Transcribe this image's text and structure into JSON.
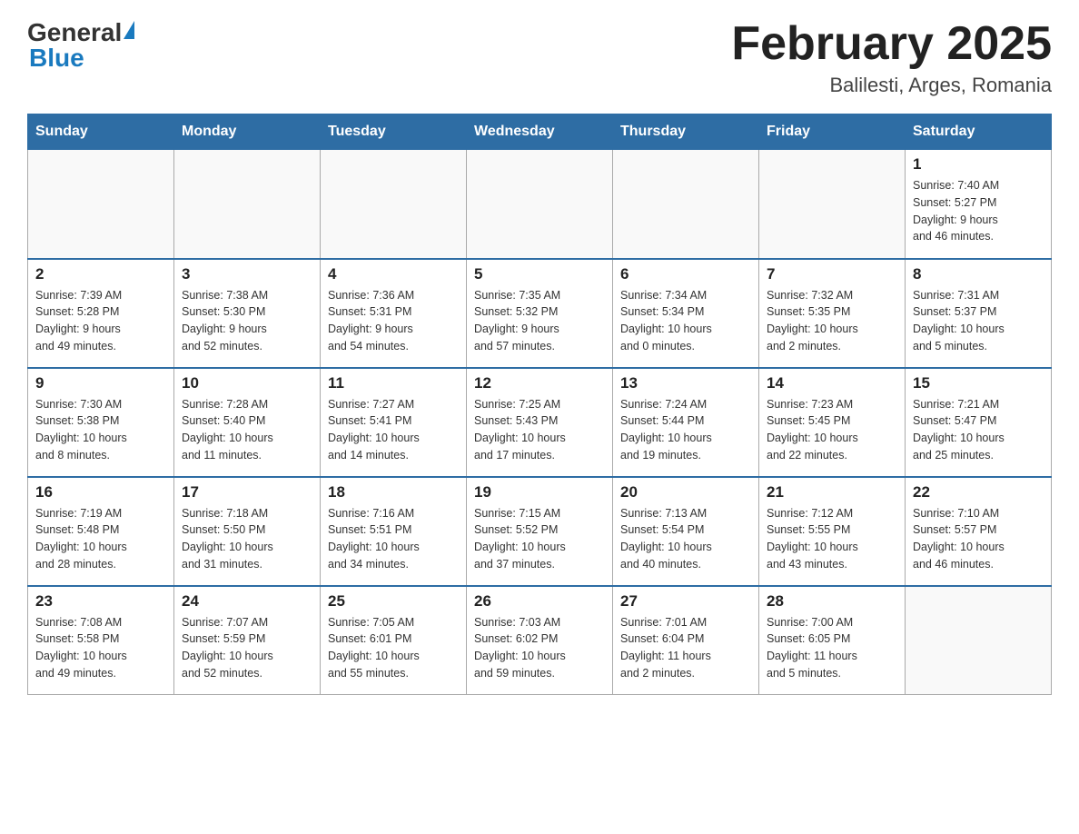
{
  "header": {
    "logo_general": "General",
    "logo_blue": "Blue",
    "title": "February 2025",
    "subtitle": "Balilesti, Arges, Romania"
  },
  "days_of_week": [
    "Sunday",
    "Monday",
    "Tuesday",
    "Wednesday",
    "Thursday",
    "Friday",
    "Saturday"
  ],
  "weeks": [
    {
      "days": [
        {
          "num": "",
          "info": ""
        },
        {
          "num": "",
          "info": ""
        },
        {
          "num": "",
          "info": ""
        },
        {
          "num": "",
          "info": ""
        },
        {
          "num": "",
          "info": ""
        },
        {
          "num": "",
          "info": ""
        },
        {
          "num": "1",
          "info": "Sunrise: 7:40 AM\nSunset: 5:27 PM\nDaylight: 9 hours\nand 46 minutes."
        }
      ]
    },
    {
      "days": [
        {
          "num": "2",
          "info": "Sunrise: 7:39 AM\nSunset: 5:28 PM\nDaylight: 9 hours\nand 49 minutes."
        },
        {
          "num": "3",
          "info": "Sunrise: 7:38 AM\nSunset: 5:30 PM\nDaylight: 9 hours\nand 52 minutes."
        },
        {
          "num": "4",
          "info": "Sunrise: 7:36 AM\nSunset: 5:31 PM\nDaylight: 9 hours\nand 54 minutes."
        },
        {
          "num": "5",
          "info": "Sunrise: 7:35 AM\nSunset: 5:32 PM\nDaylight: 9 hours\nand 57 minutes."
        },
        {
          "num": "6",
          "info": "Sunrise: 7:34 AM\nSunset: 5:34 PM\nDaylight: 10 hours\nand 0 minutes."
        },
        {
          "num": "7",
          "info": "Sunrise: 7:32 AM\nSunset: 5:35 PM\nDaylight: 10 hours\nand 2 minutes."
        },
        {
          "num": "8",
          "info": "Sunrise: 7:31 AM\nSunset: 5:37 PM\nDaylight: 10 hours\nand 5 minutes."
        }
      ]
    },
    {
      "days": [
        {
          "num": "9",
          "info": "Sunrise: 7:30 AM\nSunset: 5:38 PM\nDaylight: 10 hours\nand 8 minutes."
        },
        {
          "num": "10",
          "info": "Sunrise: 7:28 AM\nSunset: 5:40 PM\nDaylight: 10 hours\nand 11 minutes."
        },
        {
          "num": "11",
          "info": "Sunrise: 7:27 AM\nSunset: 5:41 PM\nDaylight: 10 hours\nand 14 minutes."
        },
        {
          "num": "12",
          "info": "Sunrise: 7:25 AM\nSunset: 5:43 PM\nDaylight: 10 hours\nand 17 minutes."
        },
        {
          "num": "13",
          "info": "Sunrise: 7:24 AM\nSunset: 5:44 PM\nDaylight: 10 hours\nand 19 minutes."
        },
        {
          "num": "14",
          "info": "Sunrise: 7:23 AM\nSunset: 5:45 PM\nDaylight: 10 hours\nand 22 minutes."
        },
        {
          "num": "15",
          "info": "Sunrise: 7:21 AM\nSunset: 5:47 PM\nDaylight: 10 hours\nand 25 minutes."
        }
      ]
    },
    {
      "days": [
        {
          "num": "16",
          "info": "Sunrise: 7:19 AM\nSunset: 5:48 PM\nDaylight: 10 hours\nand 28 minutes."
        },
        {
          "num": "17",
          "info": "Sunrise: 7:18 AM\nSunset: 5:50 PM\nDaylight: 10 hours\nand 31 minutes."
        },
        {
          "num": "18",
          "info": "Sunrise: 7:16 AM\nSunset: 5:51 PM\nDaylight: 10 hours\nand 34 minutes."
        },
        {
          "num": "19",
          "info": "Sunrise: 7:15 AM\nSunset: 5:52 PM\nDaylight: 10 hours\nand 37 minutes."
        },
        {
          "num": "20",
          "info": "Sunrise: 7:13 AM\nSunset: 5:54 PM\nDaylight: 10 hours\nand 40 minutes."
        },
        {
          "num": "21",
          "info": "Sunrise: 7:12 AM\nSunset: 5:55 PM\nDaylight: 10 hours\nand 43 minutes."
        },
        {
          "num": "22",
          "info": "Sunrise: 7:10 AM\nSunset: 5:57 PM\nDaylight: 10 hours\nand 46 minutes."
        }
      ]
    },
    {
      "days": [
        {
          "num": "23",
          "info": "Sunrise: 7:08 AM\nSunset: 5:58 PM\nDaylight: 10 hours\nand 49 minutes."
        },
        {
          "num": "24",
          "info": "Sunrise: 7:07 AM\nSunset: 5:59 PM\nDaylight: 10 hours\nand 52 minutes."
        },
        {
          "num": "25",
          "info": "Sunrise: 7:05 AM\nSunset: 6:01 PM\nDaylight: 10 hours\nand 55 minutes."
        },
        {
          "num": "26",
          "info": "Sunrise: 7:03 AM\nSunset: 6:02 PM\nDaylight: 10 hours\nand 59 minutes."
        },
        {
          "num": "27",
          "info": "Sunrise: 7:01 AM\nSunset: 6:04 PM\nDaylight: 11 hours\nand 2 minutes."
        },
        {
          "num": "28",
          "info": "Sunrise: 7:00 AM\nSunset: 6:05 PM\nDaylight: 11 hours\nand 5 minutes."
        },
        {
          "num": "",
          "info": ""
        }
      ]
    }
  ]
}
